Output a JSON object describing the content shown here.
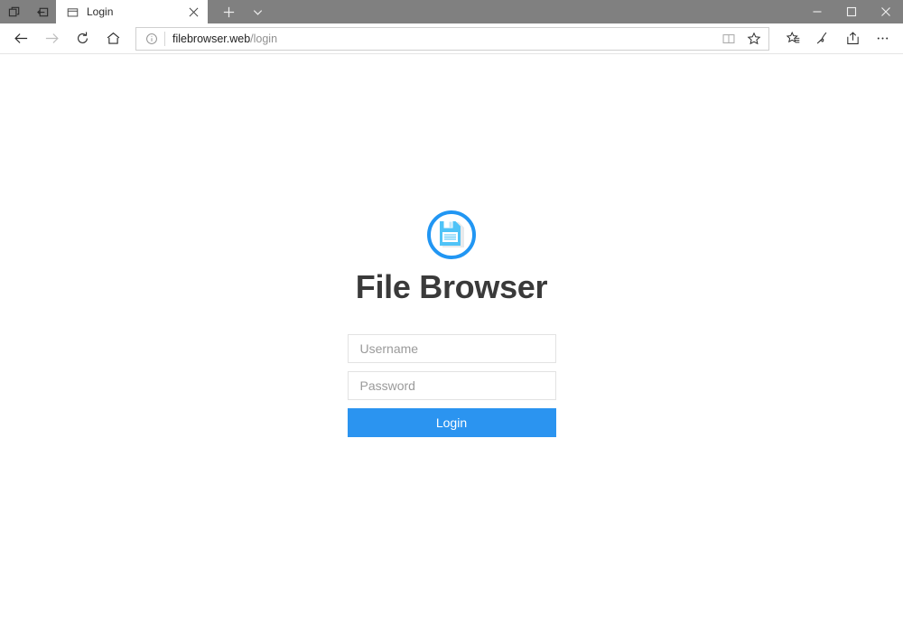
{
  "window": {
    "titlebar_icons": [
      {
        "name": "tab-preview-icon",
        "label": "Show tab previews"
      },
      {
        "name": "set-aside-tabs-icon",
        "label": "Tabs you've set aside"
      }
    ],
    "tab": {
      "title": "Login",
      "favicon": "page-icon",
      "close_label": "Close tab"
    },
    "tab_actions": [
      {
        "name": "new-tab-button",
        "glyph": "+"
      },
      {
        "name": "tab-menu-chevron-icon",
        "glyph": "⌄"
      }
    ],
    "controls": [
      {
        "name": "minimize-button",
        "glyph": "–"
      },
      {
        "name": "maximize-button",
        "glyph": "□"
      },
      {
        "name": "close-button",
        "glyph": "✕"
      }
    ]
  },
  "navigation": {
    "back_label": "Back",
    "forward_label": "Forward",
    "refresh_label": "Refresh",
    "home_label": "Home",
    "address": {
      "host": "filebrowser.web",
      "path": "/login",
      "info_icon": "site-info-icon"
    },
    "address_actions": [
      {
        "name": "reading-view-icon",
        "label": "Reading view"
      },
      {
        "name": "favorites-star-icon",
        "label": "Add to favorites"
      }
    ],
    "toolbar_actions": [
      {
        "name": "favorites-hub-icon",
        "label": "Hub (favorites, reading list, history)"
      },
      {
        "name": "web-note-icon",
        "label": "Make a Web Note"
      },
      {
        "name": "share-icon",
        "label": "Share"
      },
      {
        "name": "settings-more-icon",
        "label": "Settings and more"
      }
    ]
  },
  "page": {
    "logo": {
      "name": "file-browser-logo-floppy-disk-icon",
      "ring_color": "#2196f3",
      "disk_color": "#4fc3f7",
      "disk_shadow": "#e8eaec"
    },
    "title": "File Browser",
    "form": {
      "username": {
        "placeholder": "Username",
        "value": ""
      },
      "password": {
        "placeholder": "Password",
        "value": ""
      },
      "submit_label": "Login",
      "submit_color": "#2b94f0"
    }
  }
}
